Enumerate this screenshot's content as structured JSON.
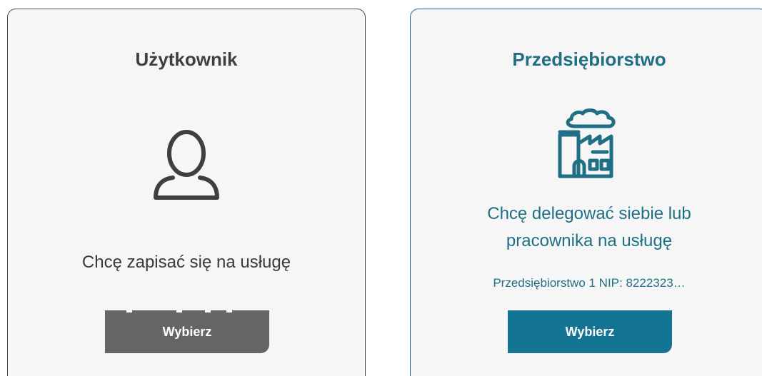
{
  "cards": {
    "user": {
      "title": "Użytkownik",
      "description": "Chcę zapisać się na usługę",
      "button_label": "Wybierz",
      "icon": "user-icon"
    },
    "company": {
      "title": "Przedsiębiorstwo",
      "description_line1": "Chcę delegować siebie lub",
      "description_line2": "pracownika na usługę",
      "company_info": "Przedsiębiorstwo 1 NIP: 8222323…",
      "button_label": "Wybierz",
      "icon": "factory-icon"
    }
  },
  "colors": {
    "user_text": "#3f3f3f",
    "company_accent": "#1f6f85",
    "user_button": "#646566",
    "company_button": "#147494"
  }
}
